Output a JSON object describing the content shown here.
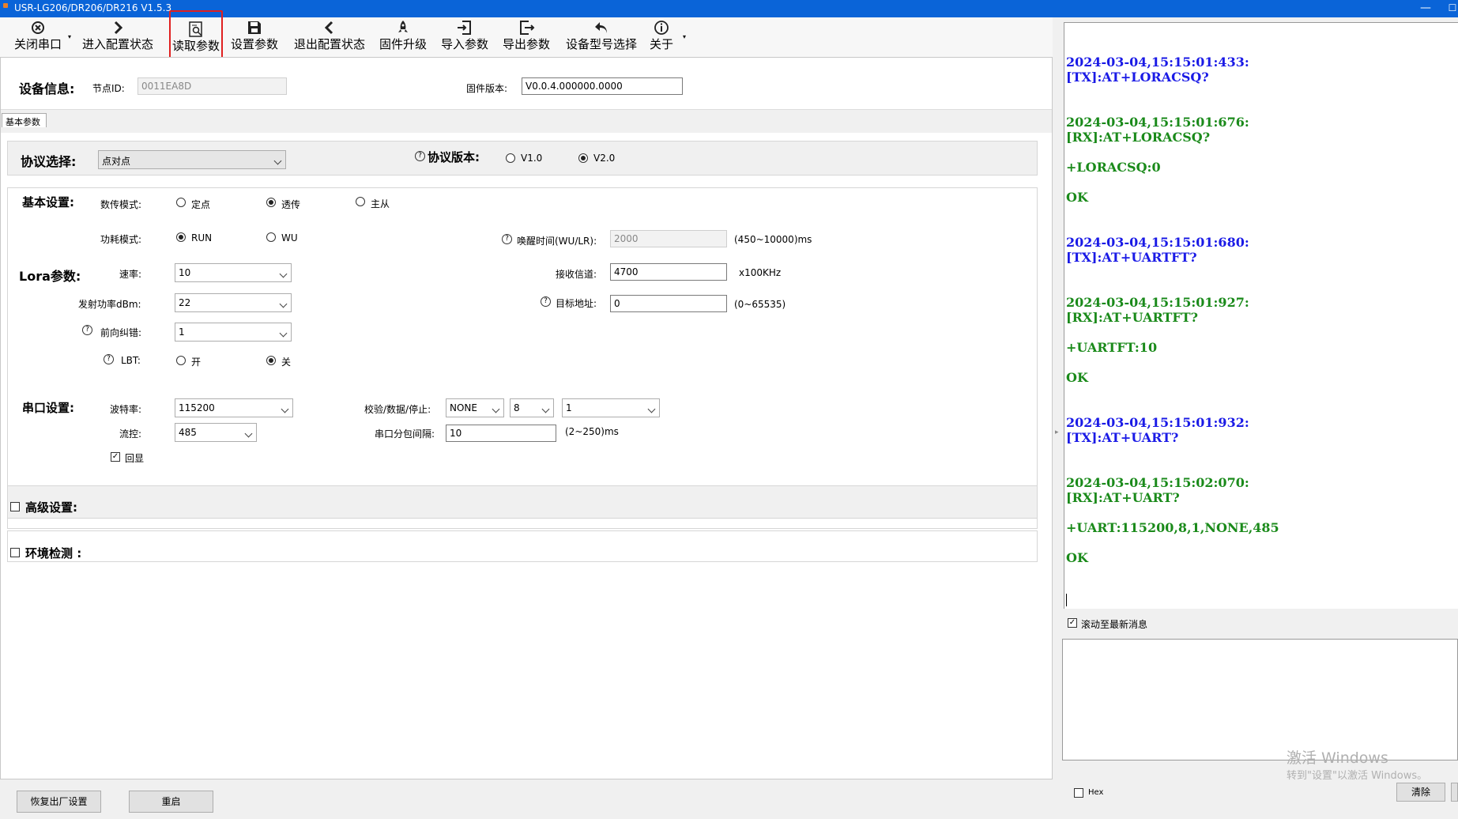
{
  "window": {
    "title": "USR-LG206/DR206/DR216 V1.5.3",
    "minimize": "—",
    "maximize": "☐"
  },
  "toolbar": [
    {
      "label": "关闭串口",
      "icon": "close-port-icon"
    },
    {
      "label": "进入配置状态",
      "icon": "enter-config-icon"
    },
    {
      "label": "读取参数",
      "icon": "read-params-icon"
    },
    {
      "label": "设置参数",
      "icon": "save-icon"
    },
    {
      "label": "退出配置状态",
      "icon": "exit-config-icon"
    },
    {
      "label": "固件升级",
      "icon": "rocket-icon"
    },
    {
      "label": "导入参数",
      "icon": "import-icon"
    },
    {
      "label": "导出参数",
      "icon": "export-icon"
    },
    {
      "label": "设备型号选择",
      "icon": "undo-icon"
    },
    {
      "label": "关于",
      "icon": "info-icon"
    }
  ],
  "device": {
    "section_label": "设备信息:",
    "node_id_label": "节点ID:",
    "node_id_value": "0011EA8D",
    "firmware_label": "固件版本:",
    "firmware_value": "V0.0.4.000000.0000"
  },
  "tab": {
    "label": "基本参数"
  },
  "protocol": {
    "label": "协议选择:",
    "value": "点对点",
    "version_label": "协议版本:",
    "v1": "V1.0",
    "v2": "V2.0",
    "selected_version": "V2.0"
  },
  "basic": {
    "section_label": "基本设置:",
    "mode_label": "数传模式:",
    "mode_options": [
      "定点",
      "透传",
      "主从"
    ],
    "mode_selected": "透传",
    "power_label": "功耗模式:",
    "power_options": [
      "RUN",
      "WU"
    ],
    "power_selected": "RUN",
    "wake_label": "唤醒时间(WU/LR):",
    "wake_value": "2000",
    "wake_range": "(450~10000)ms"
  },
  "lora": {
    "section_label": "Lora参数:",
    "rate_label": "速率:",
    "rate_value": "10",
    "channel_label": "接收信道:",
    "channel_value": "4700",
    "channel_unit": "x100KHz",
    "tx_power_label": "发射功率dBm:",
    "tx_power_value": "22",
    "target_label": "目标地址:",
    "target_value": "0",
    "target_range": "(0~65535)",
    "fec_label": "前向纠错:",
    "fec_value": "1",
    "lbt_label": "LBT:",
    "lbt_on": "开",
    "lbt_off": "关",
    "lbt_selected": "关"
  },
  "serial": {
    "section_label": "串口设置:",
    "baud_label": "波特率:",
    "baud_value": "115200",
    "parity_label": "校验/数据/停止:",
    "parity_value": "NONE",
    "data_value": "8",
    "stop_value": "1",
    "flow_label": "流控:",
    "flow_value": "485",
    "interval_label": "串口分包间隔:",
    "interval_value": "10",
    "interval_range": "(2~250)ms",
    "echo_label": "回显",
    "echo_checked": true
  },
  "advanced": {
    "label": "高级设置:"
  },
  "env": {
    "label": "环境检测 :"
  },
  "log": [
    {
      "type": "tx",
      "text": "2024-03-04,15:15:01:433:"
    },
    {
      "type": "tx",
      "text": "[TX]:AT+LORACSQ?"
    },
    {
      "type": "rx",
      "text": "2024-03-04,15:15:01:676:"
    },
    {
      "type": "rx",
      "text": "[RX]:AT+LORACSQ?"
    },
    {
      "type": "rx",
      "text": "+LORACSQ:0"
    },
    {
      "type": "rx",
      "text": "OK"
    },
    {
      "type": "tx",
      "text": "2024-03-04,15:15:01:680:"
    },
    {
      "type": "tx",
      "text": "[TX]:AT+UARTFT?"
    },
    {
      "type": "rx",
      "text": "2024-03-04,15:15:01:927:"
    },
    {
      "type": "rx",
      "text": "[RX]:AT+UARTFT?"
    },
    {
      "type": "rx",
      "text": "+UARTFT:10"
    },
    {
      "type": "rx",
      "text": "OK"
    },
    {
      "type": "tx",
      "text": "2024-03-04,15:15:01:932:"
    },
    {
      "type": "tx",
      "text": "[TX]:AT+UART?"
    },
    {
      "type": "rx",
      "text": "2024-03-04,15:15:02:070:"
    },
    {
      "type": "rx",
      "text": "[RX]:AT+UART?"
    },
    {
      "type": "rx",
      "text": "+UART:115200,8,1,NONE,485"
    },
    {
      "type": "rx",
      "text": "OK"
    }
  ],
  "scroll_latest": {
    "label": "滚动至最新消息",
    "checked": true
  },
  "hex": {
    "label": "Hex",
    "checked": false
  },
  "clear_button": "清除",
  "footer": {
    "factory_reset": "恢复出厂设置",
    "restart": "重启"
  },
  "watermark": {
    "line1": "激活 Windows",
    "line2": "转到\"设置\"以激活 Windows。"
  },
  "colors": {
    "titlebar": "#0a64d8",
    "tx": "#1a1ae6",
    "rx": "#1a8a1a",
    "highlight": "#e02020"
  }
}
